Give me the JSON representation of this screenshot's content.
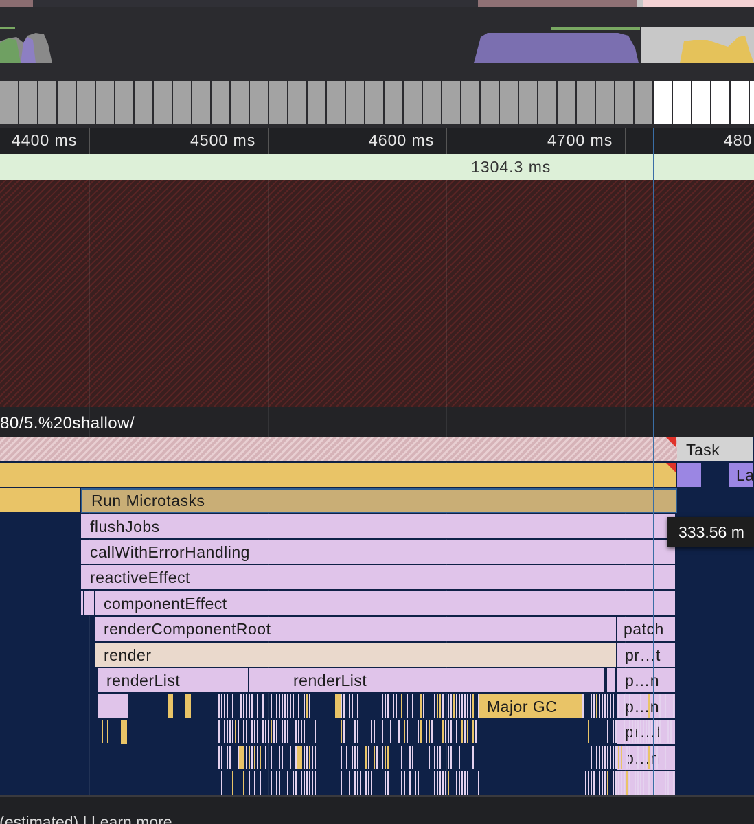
{
  "ruler": {
    "ticks": [
      "4400 ms",
      "4500 ms",
      "4600 ms",
      "4700 ms",
      "480"
    ]
  },
  "selection": {
    "duration": "1304.3 ms"
  },
  "thread": {
    "url": "80/5.%20shallow/"
  },
  "flame": {
    "task_label": "Task",
    "la_label": "La",
    "run_microtasks": "Run Microtasks",
    "flush_jobs": "flushJobs",
    "call_with_error": "callWithErrorHandling",
    "reactive_effect": "reactiveEffect",
    "component_effect": "componentEffect",
    "render_component_root": "renderComponentRoot",
    "patch": "patch",
    "render": "render",
    "pr_t_1": "pr…t",
    "render_list_1": "renderList",
    "render_list_2": "renderList",
    "p_n_1": "p…n",
    "major_gc": "Major GC",
    "p_n_2": "p…n",
    "pr_t_2": "pr…t",
    "p_n_3": "p…n"
  },
  "tooltip": {
    "text": "333.56 m"
  },
  "footer": {
    "text": "e (estimated) | Learn more"
  },
  "colors": {
    "flame_bg": "#0f2147",
    "scripting": "#e9c467",
    "function_call": "#e0c4ea",
    "selection_green": "#ddf0d8",
    "cursor": "#3a6ea5"
  }
}
